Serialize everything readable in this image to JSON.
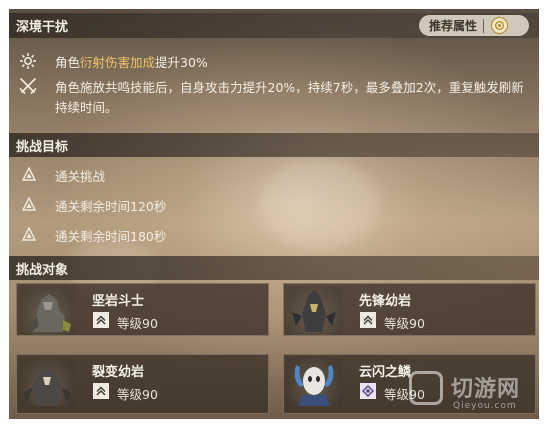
{
  "interference": {
    "title": "深境干扰",
    "recommend_label": "推荐属性",
    "effects": [
      {
        "icon": "sun-burst-icon",
        "prefix": "角色",
        "highlight": "衍射伤害加成",
        "suffix": "提升30%"
      },
      {
        "icon": "crossed-swords-icon",
        "text": "角色施放共鸣技能后，自身攻击力提升20%，持续7秒，最多叠加2次，重复触发刷新持续时间。"
      }
    ]
  },
  "objectives": {
    "title": "挑战目标",
    "items": [
      {
        "icon": "triangle-rune-icon",
        "label": "通关挑战"
      },
      {
        "icon": "triangle-rune-icon",
        "label": "通关剩余时间120秒"
      },
      {
        "icon": "triangle-rune-icon",
        "label": "通关剩余时间180秒"
      }
    ]
  },
  "targets": {
    "title": "挑战对象",
    "items": [
      {
        "name": "坚岩斗士",
        "level": "等级90",
        "badge_icon": "chevron-rank-icon"
      },
      {
        "name": "先锋幼岩",
        "level": "等级90",
        "badge_icon": "chevron-rank-icon"
      },
      {
        "name": "裂变幼岩",
        "level": "等级90",
        "badge_icon": "chevron-rank-icon"
      },
      {
        "name": "云闪之鳞",
        "level": "等级90",
        "badge_icon": "boss-rank-icon"
      }
    ]
  },
  "watermark": {
    "text": "切游网",
    "url": "Qieyou.com"
  },
  "colors": {
    "highlight": "#f0c46a",
    "header_bg": "#342c24",
    "card_bg": "#3a3026",
    "badge_gold": "#b08a33"
  }
}
